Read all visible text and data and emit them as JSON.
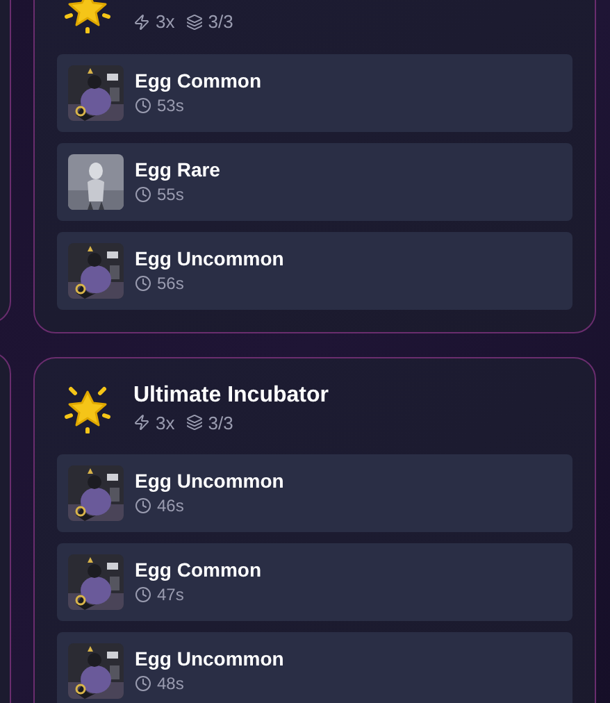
{
  "incubators": [
    {
      "multiplier": "3x",
      "capacity": "3/3",
      "eggs": [
        {
          "name": "Egg Common",
          "time": "53s"
        },
        {
          "name": "Egg Rare",
          "time": "55s"
        },
        {
          "name": "Egg Uncommon",
          "time": "56s"
        }
      ]
    },
    {
      "title": "Ultimate Incubator",
      "multiplier": "3x",
      "capacity": "3/3",
      "eggs": [
        {
          "name": "Egg Uncommon",
          "time": "46s"
        },
        {
          "name": "Egg Common",
          "time": "47s"
        },
        {
          "name": "Egg Uncommon",
          "time": "48s"
        }
      ]
    }
  ]
}
